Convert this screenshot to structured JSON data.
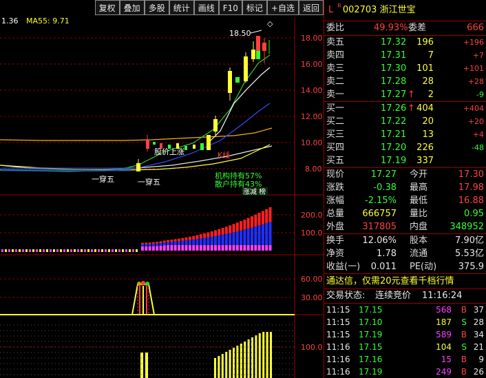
{
  "toolbar": [
    "复权",
    "叠加",
    "多股",
    "统计",
    "画线",
    "F10",
    "标记",
    "+自选",
    "返回"
  ],
  "ma_legend": {
    "left": "1.36",
    "ma55": "MA55: 9.71"
  },
  "stock": {
    "flag": "L",
    "mark": "R",
    "code": "002703",
    "name": "浙江世宝"
  },
  "price_axis": [
    "18.00",
    "16.00",
    "14.00",
    "12.00",
    "10.00",
    "8.00"
  ],
  "volume_axis": [
    "200.0",
    "100.0"
  ],
  "indicator_axis": [
    "60.00",
    "30.00"
  ],
  "bottom_axis": [
    "100.0"
  ],
  "annotations": {
    "high": "18.50",
    "pierce1": "一穿五",
    "pierce2": "一穿五",
    "bull": "股价上涨",
    "kline": "K线",
    "inst": "机构持有57%",
    "retail": "散户持有43%",
    "tag": "涨减 榜"
  },
  "weibi": {
    "label": "委比",
    "value": "49.93%",
    "label2": "委差",
    "value2": "666"
  },
  "asks": [
    {
      "label": "卖五",
      "price": "17.32",
      "vol": "196",
      "delta": "+196"
    },
    {
      "label": "卖四",
      "price": "17.31",
      "vol": "7",
      "delta": "+7"
    },
    {
      "label": "卖三",
      "price": "17.30",
      "vol": "101",
      "delta": "+101"
    },
    {
      "label": "卖二",
      "price": "17.28",
      "vol": "28",
      "delta": "+28"
    },
    {
      "label": "卖一",
      "price": "17.27",
      "vol": "2",
      "delta": "-9",
      "arrow": "↑"
    }
  ],
  "bids": [
    {
      "label": "买一",
      "price": "17.26",
      "vol": "404",
      "delta": "+404",
      "arrow": "↑"
    },
    {
      "label": "买二",
      "price": "17.22",
      "vol": "20",
      "delta": "+20"
    },
    {
      "label": "买三",
      "price": "17.21",
      "vol": "13",
      "delta": "+4"
    },
    {
      "label": "买四",
      "price": "17.20",
      "vol": "226",
      "delta": "-48"
    },
    {
      "label": "买五",
      "price": "17.19",
      "vol": "337",
      "delta": ""
    }
  ],
  "stats": [
    {
      "l1": "现价",
      "v1": "17.27",
      "l2": "今开",
      "v2": "17.30"
    },
    {
      "l1": "涨跌",
      "v1": "-0.38",
      "l2": "最高",
      "v2": "17.98"
    },
    {
      "l1": "涨幅",
      "v1": "-2.15%",
      "l2": "最低",
      "v2": "16.88"
    },
    {
      "l1": "总量",
      "v1": "666757",
      "l2": "量比",
      "v2": "0.95"
    },
    {
      "l1": "外盘",
      "v1": "317805",
      "l2": "内盘",
      "v2": "348952"
    }
  ],
  "stats2": [
    {
      "l1": "换手",
      "v1": "12.06%",
      "l2": "股本",
      "v2": "7.90亿"
    },
    {
      "l1": "净资",
      "v1": "1.78",
      "l2": "流通",
      "v2": "5.53亿"
    },
    {
      "l1": "收益(一)",
      "v1": "0.011",
      "l2": "PE(动)",
      "v2": "375.9"
    }
  ],
  "promo": "通达信，仅需20元查看千档行情",
  "trade_status": {
    "label": "交易状态:",
    "value": "连续竞价",
    "time": "11:16:24"
  },
  "ticks": [
    {
      "time": "11:15",
      "price": "17.15",
      "vol": "568",
      "bs": "B",
      "n": "37"
    },
    {
      "time": "11:15",
      "price": "17.10",
      "vol": "187",
      "bs": "S",
      "n": "28"
    },
    {
      "time": "11:15",
      "price": "17.19",
      "vol": "589",
      "bs": "B",
      "n": "34"
    },
    {
      "time": "11:16",
      "price": "17.15",
      "vol": "104",
      "bs": "S",
      "n": "21"
    },
    {
      "time": "11:16",
      "price": "17.16",
      "vol": "15",
      "bs": "B",
      "n": "9"
    },
    {
      "time": "11:16",
      "price": "17.19",
      "vol": "249",
      "bs": "B",
      "n": "26"
    }
  ]
}
